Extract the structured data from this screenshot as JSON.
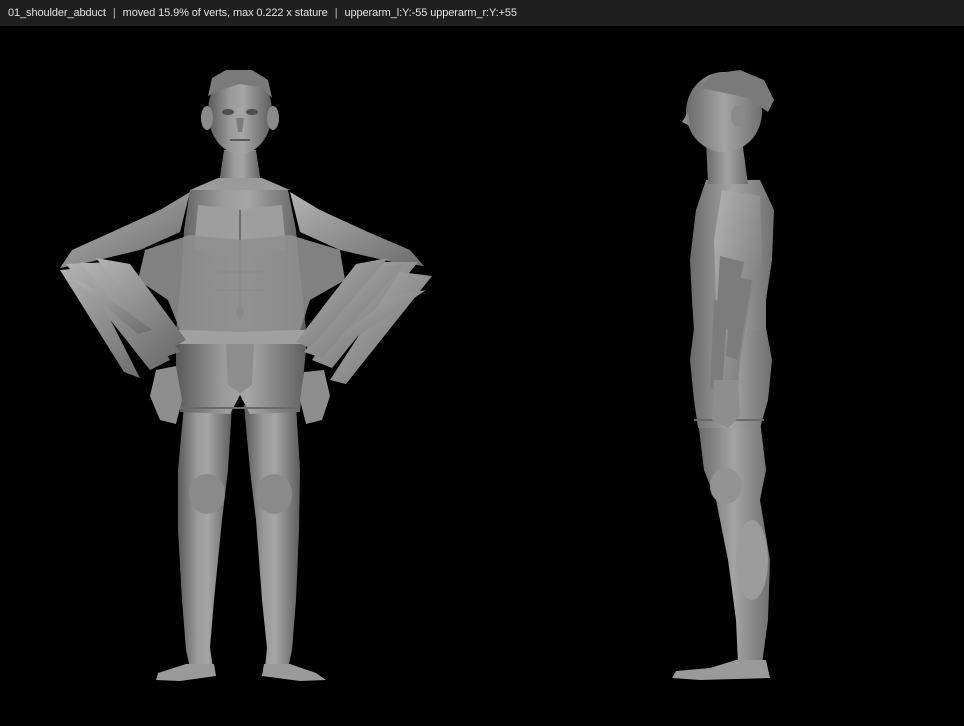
{
  "status_bar": {
    "scene_name": "01_shoulder_abduct",
    "deform_stats": "moved 15.9% of verts, max 0.222 x stature",
    "pose_params": "upperarm_l:Y:-55 upperarm_r:Y:+55",
    "separator": "|"
  },
  "viewport": {
    "background_color": "#000000",
    "mesh_color": "#8e8e8e",
    "views": [
      "front-view",
      "side-view"
    ]
  }
}
